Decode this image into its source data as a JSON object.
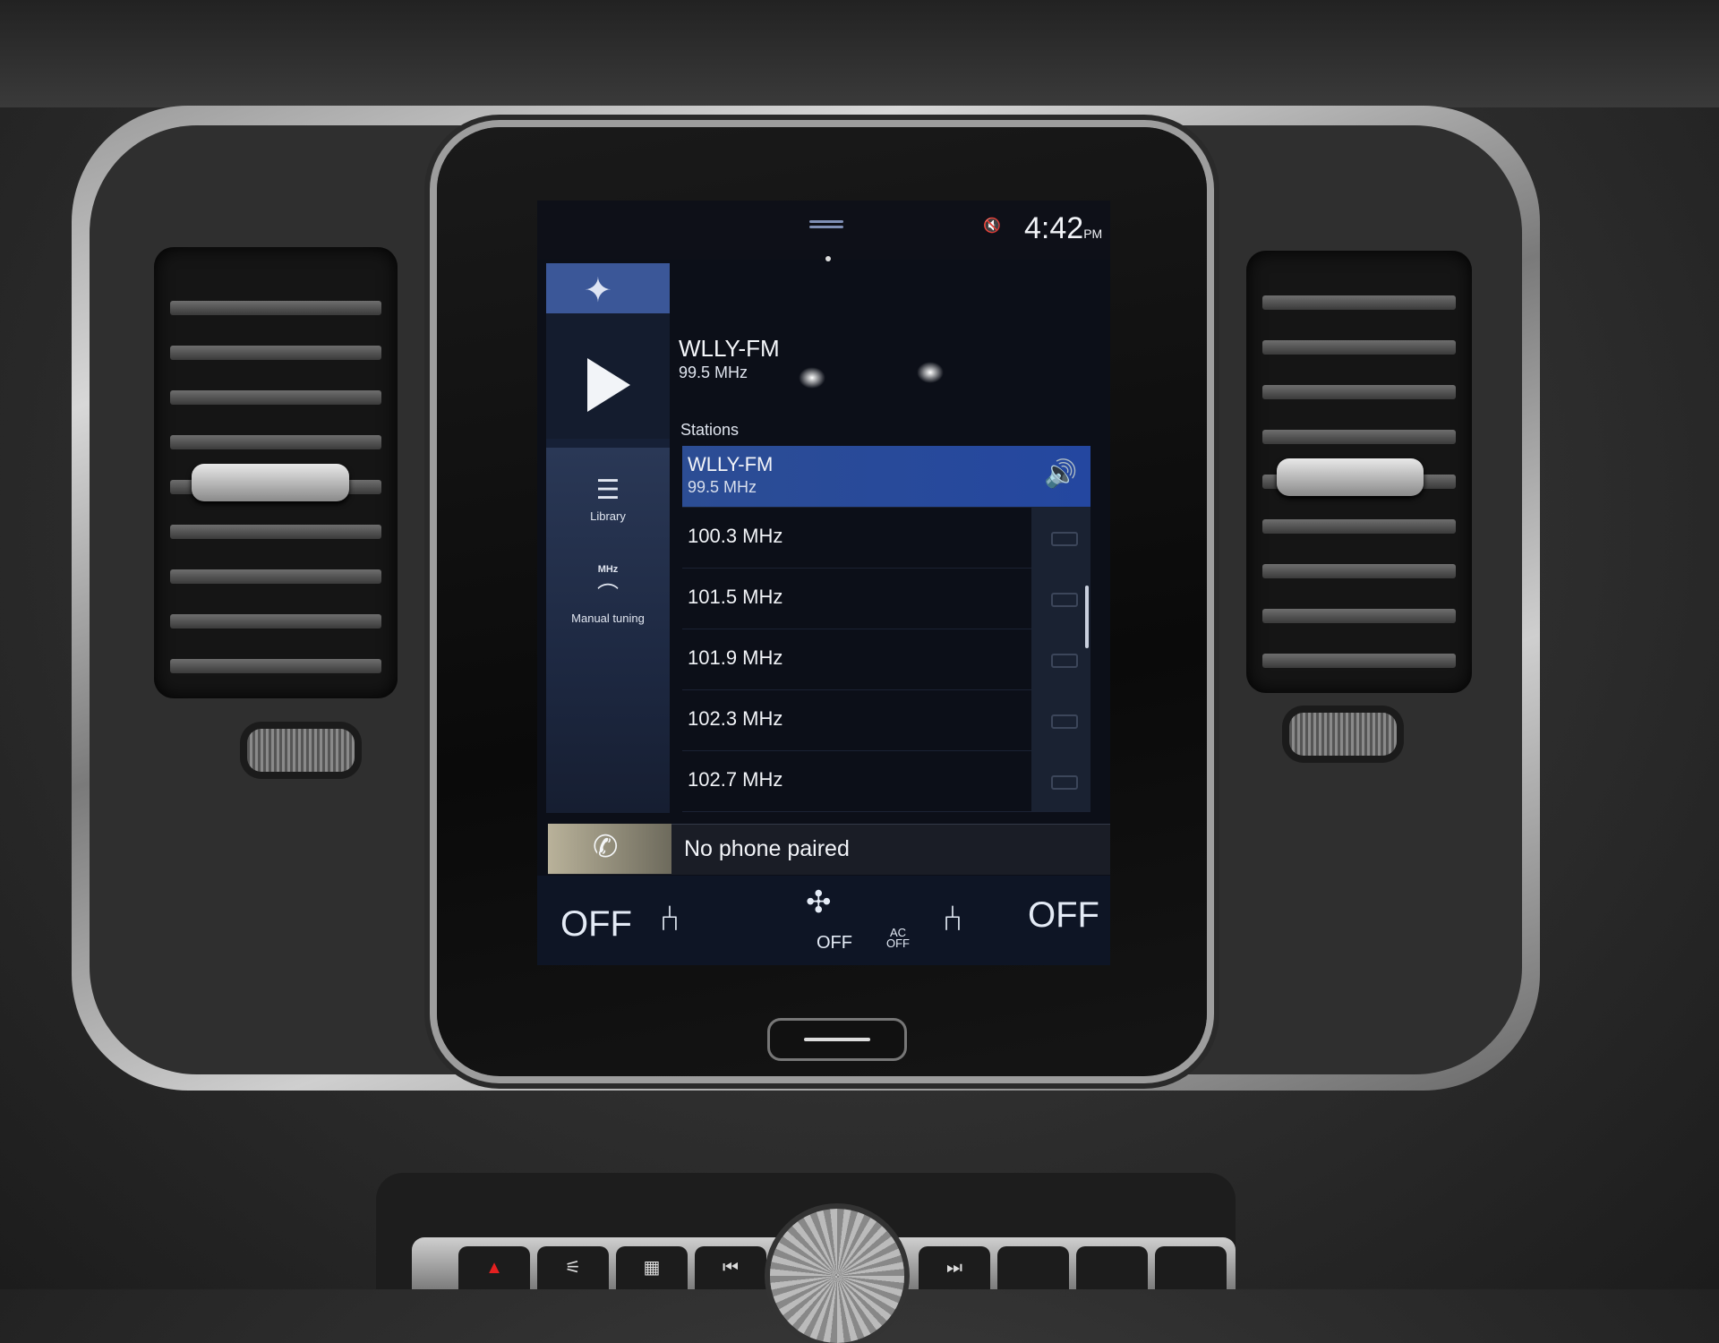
{
  "status_bar": {
    "time": "4:42",
    "ampm": "PM",
    "mute_icon": "speaker-muted-icon"
  },
  "sidebar": {
    "nav_icon": "compass-icon",
    "play_icon": "play-icon",
    "items": [
      {
        "id": "library",
        "label": "Library",
        "icon": "list-icon"
      },
      {
        "id": "manual-tuning",
        "label": "Manual tuning",
        "badge": "MHz",
        "icon": "tuning-dial-icon"
      }
    ]
  },
  "now_playing": {
    "station": "WLLY-FM",
    "frequency": "99.5 MHz"
  },
  "stations": {
    "label": "Stations",
    "items": [
      {
        "name": "WLLY-FM",
        "frequency": "99.5 MHz",
        "active": true
      },
      {
        "frequency": "100.3 MHz"
      },
      {
        "frequency": "101.5 MHz"
      },
      {
        "frequency": "101.9 MHz"
      },
      {
        "frequency": "102.3 MHz"
      },
      {
        "frequency": "102.7 MHz"
      }
    ]
  },
  "phone": {
    "text": "No phone paired",
    "icon": "phone-icon"
  },
  "climate": {
    "left_temp": "OFF",
    "right_temp": "OFF",
    "fan": "OFF",
    "ac_top": "AC",
    "ac_bottom": "OFF"
  },
  "colors": {
    "accent": "#2a4a9a",
    "screen_bg": "#0c0f18"
  }
}
